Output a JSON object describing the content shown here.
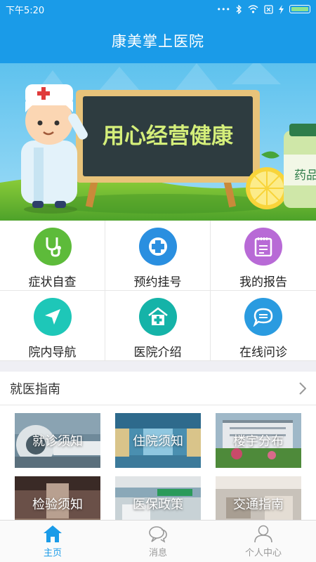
{
  "status": {
    "time": "下午5:20",
    "icons": [
      "dots-icon",
      "bluetooth-icon",
      "wifi-icon",
      "sim-icon",
      "charging-icon",
      "battery-icon"
    ]
  },
  "header": {
    "title": "康美掌上医院"
  },
  "banner": {
    "board_text": "用心经营健康",
    "bottle_label": "药品"
  },
  "menu": [
    {
      "label": "症状自查",
      "icon": "stethoscope-icon",
      "color": "#5dbb3a"
    },
    {
      "label": "预约挂号",
      "icon": "medical-cross-icon",
      "color": "#2a8fe0"
    },
    {
      "label": "我的报告",
      "icon": "report-icon",
      "color": "#b86ad6"
    },
    {
      "label": "院内导航",
      "icon": "navigation-icon",
      "color": "#1ec7b8"
    },
    {
      "label": "医院介绍",
      "icon": "hospital-icon",
      "color": "#15b3a8"
    },
    {
      "label": "在线问诊",
      "icon": "chat-icon",
      "color": "#2a9be0"
    }
  ],
  "guide": {
    "title": "就医指南",
    "items": [
      {
        "label": "就诊须知"
      },
      {
        "label": "住院须知"
      },
      {
        "label": "楼宇分布"
      },
      {
        "label": "检验须知"
      },
      {
        "label": "医保政策"
      },
      {
        "label": "交通指南"
      }
    ]
  },
  "tabs": [
    {
      "label": "主页",
      "icon": "home-icon",
      "active": true
    },
    {
      "label": "消息",
      "icon": "message-icon",
      "active": false
    },
    {
      "label": "个人中心",
      "icon": "user-icon",
      "active": false
    }
  ],
  "colors": {
    "primary": "#1a9be8",
    "tab_active": "#1a9be8",
    "tab_inactive": "#999999"
  }
}
